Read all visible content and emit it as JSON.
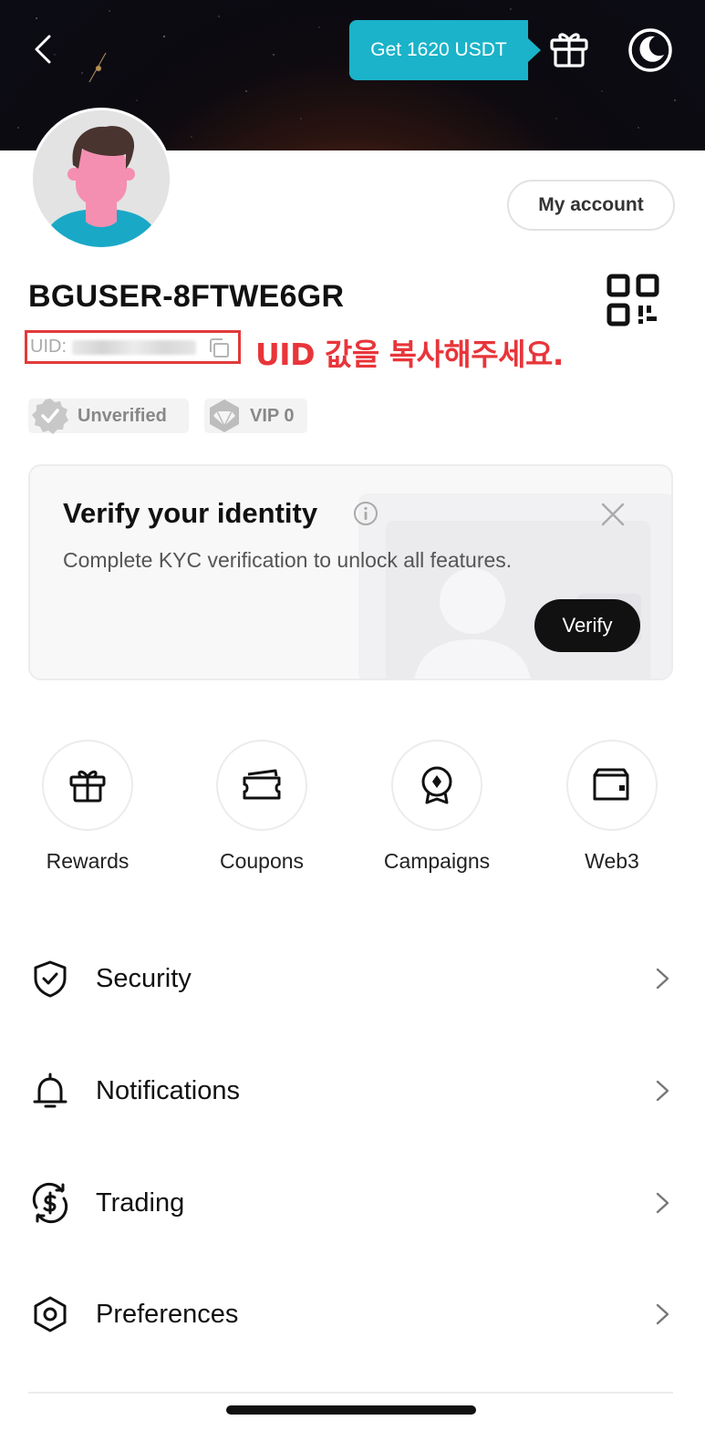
{
  "header": {
    "promo_label": "Get 1620 USDT",
    "icons": [
      "back-arrow-icon",
      "gift-icon",
      "moon-icon"
    ]
  },
  "profile": {
    "account_button": "My account",
    "username": "BGUSER-8FTWE6GR",
    "uid_label": "UID:",
    "uid_note": "UID 값을 복사해주세요.",
    "badges": [
      {
        "label": "Unverified",
        "icon": "verified-badge-icon"
      },
      {
        "label": "VIP 0",
        "icon": "diamond-icon"
      }
    ]
  },
  "kyc": {
    "title": "Verify your identity",
    "description": "Complete KYC verification to unlock all features.",
    "button": "Verify"
  },
  "actions": [
    {
      "label": "Rewards",
      "icon": "gift-icon"
    },
    {
      "label": "Coupons",
      "icon": "ticket-icon"
    },
    {
      "label": "Campaigns",
      "icon": "medal-icon"
    },
    {
      "label": "Web3",
      "icon": "wallet-icon"
    }
  ],
  "menu": [
    {
      "label": "Security",
      "icon": "shield-check-icon"
    },
    {
      "label": "Notifications",
      "icon": "bell-icon"
    },
    {
      "label": "Trading",
      "icon": "dollar-cycle-icon"
    },
    {
      "label": "Preferences",
      "icon": "hexagon-settings-icon"
    }
  ],
  "colors": {
    "promo": "#1ab3c9",
    "highlight_border": "#e03a3a",
    "highlight_text": "#e8353a",
    "primary_button": "#111111"
  }
}
